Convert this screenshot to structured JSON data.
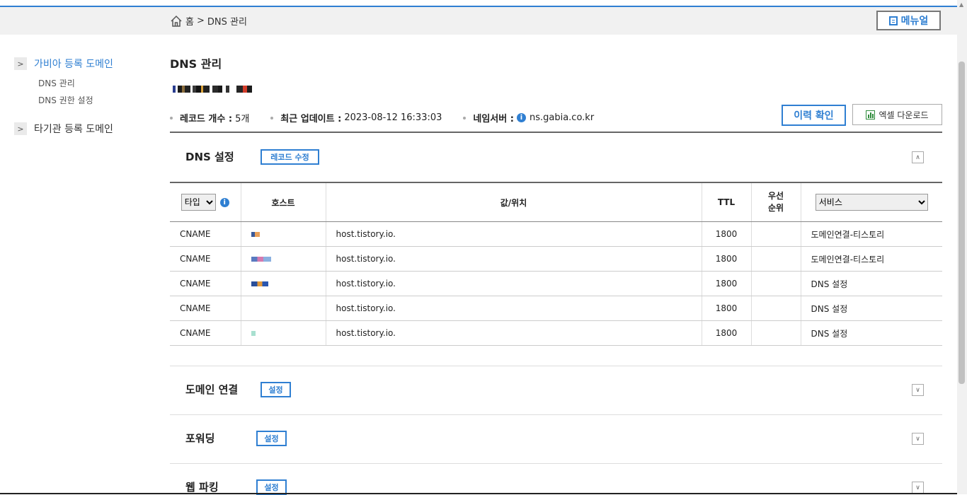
{
  "breadcrumb": {
    "home": "홈",
    "separator": ">",
    "current": "DNS 관리"
  },
  "header": {
    "manual_label": "메뉴얼"
  },
  "sidebar": {
    "groups": [
      {
        "label": "가비아 등록 도메인",
        "color": "#2f7fd2",
        "children": [
          "DNS 관리",
          "DNS 권한 설정"
        ]
      },
      {
        "label": "타기관 등록 도메인",
        "color": "#333333",
        "children": []
      }
    ]
  },
  "main": {
    "title": "DNS 관리",
    "info": {
      "record_count_label": "레코드 개수 :",
      "record_count_value": "5개",
      "updated_label": "최근 업데이트 :",
      "updated_value": "2023-08-12 16:33:03",
      "nameserver_label": "네임서버 :",
      "nameserver_value": "ns.gabia.co.kr"
    },
    "history_button": "이력 확인",
    "excel_button": "엑셀 다운로드"
  },
  "dns_section": {
    "title": "DNS 설정",
    "edit_button": "레코드 수정",
    "columns": {
      "type": "타입",
      "host": "호스트",
      "value": "값/위치",
      "ttl": "TTL",
      "priority": "우선\n순위",
      "service": "서비스"
    },
    "type_select_value": "타입",
    "service_select_value": "서비스",
    "rows": [
      {
        "type": "CNAME",
        "value": "host.tistory.io.",
        "ttl": "1800",
        "priority": "",
        "service": "도메인연결-티스토리"
      },
      {
        "type": "CNAME",
        "value": "host.tistory.io.",
        "ttl": "1800",
        "priority": "",
        "service": "도메인연결-티스토리"
      },
      {
        "type": "CNAME",
        "value": "host.tistory.io.",
        "ttl": "1800",
        "priority": "",
        "service": "DNS 설정"
      },
      {
        "type": "CNAME",
        "value": "host.tistory.io.",
        "ttl": "1800",
        "priority": "",
        "service": "DNS 설정"
      },
      {
        "type": "CNAME",
        "value": "host.tistory.io.",
        "ttl": "1800",
        "priority": "",
        "service": "DNS 설정"
      }
    ]
  },
  "sections": [
    {
      "title": "도메인 연결",
      "button": "설정"
    },
    {
      "title": "포워딩",
      "button": "설정"
    },
    {
      "title": "웹 파킹",
      "button": "설정"
    }
  ],
  "colors": {
    "accent": "#2f7fd2"
  }
}
